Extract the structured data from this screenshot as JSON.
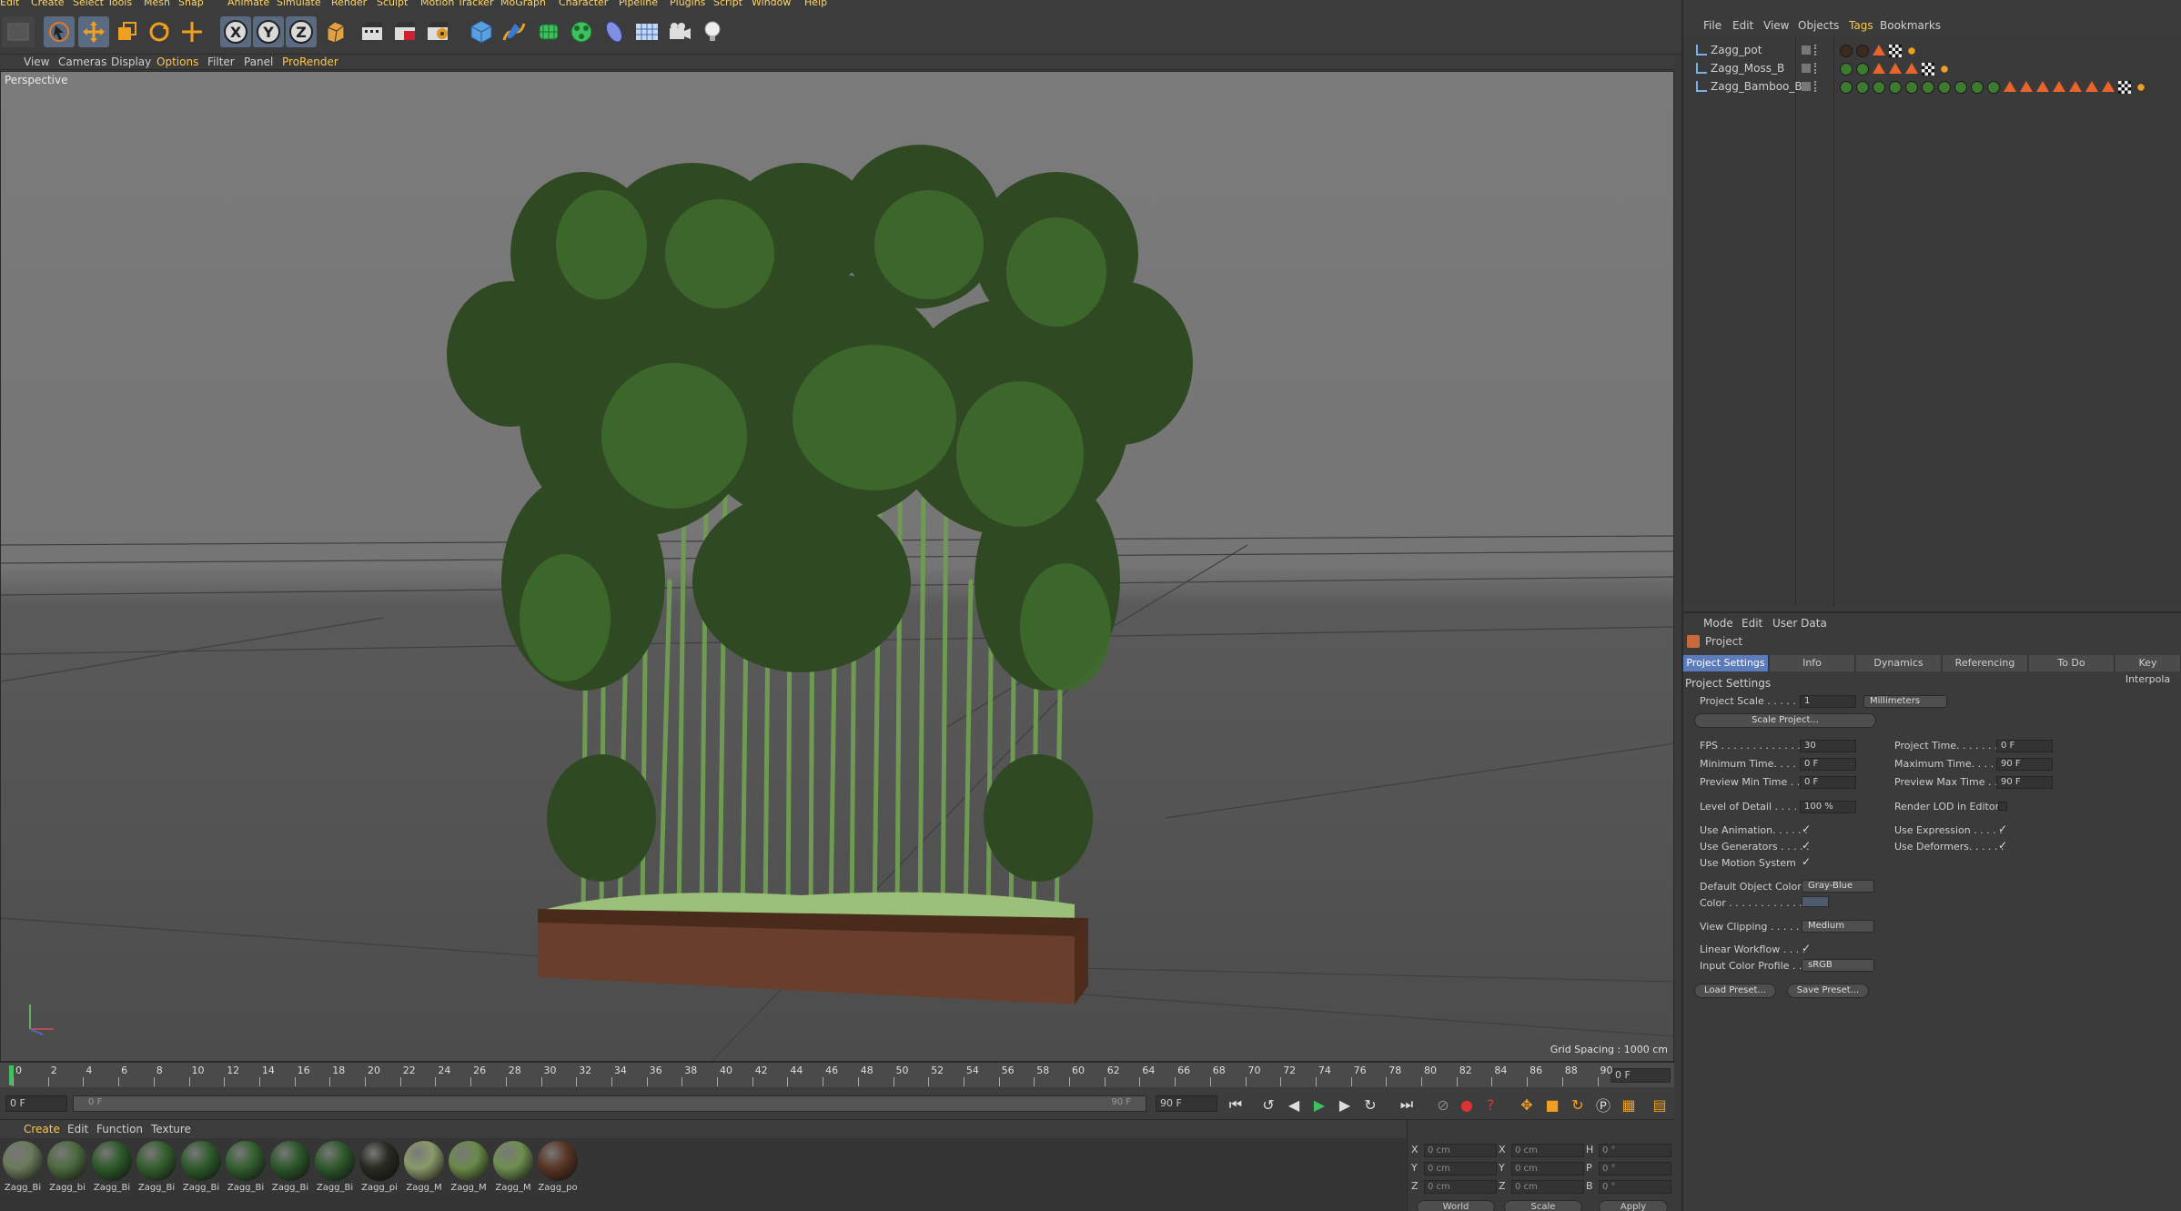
{
  "menubar": [
    "Edit",
    "Create",
    "Select",
    "Tools",
    "Mesh",
    "Snap",
    "Animate",
    "Simulate",
    "Render",
    "Sculpt",
    "Motion Tracker",
    "MoGraph",
    "Character",
    "Pipeline",
    "Plugins",
    "Script",
    "Window",
    "Help"
  ],
  "viewport": {
    "menu": [
      "View",
      "Cameras",
      "Display",
      "Options",
      "Filter",
      "Panel",
      "ProRender"
    ],
    "label": "Perspective",
    "grid_spacing": "Grid Spacing : 1000 cm"
  },
  "timeline": {
    "ticks": [
      "0",
      "2",
      "4",
      "6",
      "8",
      "10",
      "12",
      "14",
      "16",
      "18",
      "20",
      "22",
      "24",
      "26",
      "28",
      "30",
      "32",
      "34",
      "36",
      "38",
      "40",
      "42",
      "44",
      "46",
      "48",
      "50",
      "52",
      "54",
      "56",
      "58",
      "60",
      "62",
      "64",
      "66",
      "68",
      "70",
      "72",
      "74",
      "76",
      "78",
      "80",
      "82",
      "84",
      "86",
      "88",
      "90"
    ],
    "current_frame": "0 F"
  },
  "transport": {
    "start": "0 F",
    "range_start": "0 F",
    "range_end": "90 F",
    "end": "90 F"
  },
  "materials": {
    "menu": [
      "Create",
      "Edit",
      "Function",
      "Texture"
    ],
    "items": [
      {
        "label": "Zagg_Bi",
        "color": "#6a7a5a"
      },
      {
        "label": "Zagg_bi",
        "color": "#4d6a3f"
      },
      {
        "label": "Zagg_Bi",
        "color": "#2e5a2a"
      },
      {
        "label": "Zagg_Bi",
        "color": "#355f30"
      },
      {
        "label": "Zagg_Bi",
        "color": "#2f5c2d"
      },
      {
        "label": "Zagg_Bi",
        "color": "#33602f"
      },
      {
        "label": "Zagg_Bi",
        "color": "#2d582b"
      },
      {
        "label": "Zagg_Bi",
        "color": "#2e5a2c"
      },
      {
        "label": "Zagg_pi",
        "color": "#2a2a22"
      },
      {
        "label": "Zagg_M",
        "color": "#8a9a6a"
      },
      {
        "label": "Zagg_M",
        "color": "#6a8a4a"
      },
      {
        "label": "Zagg_M",
        "color": "#6f8f50"
      },
      {
        "label": "Zagg_po",
        "color": "#5a3626"
      }
    ]
  },
  "coords": {
    "rows": [
      {
        "a": "X",
        "av": "0 cm",
        "b": "X",
        "bv": "0 cm",
        "c": "H",
        "cv": "0 °"
      },
      {
        "a": "Y",
        "av": "0 cm",
        "b": "Y",
        "bv": "0 cm",
        "c": "P",
        "cv": "0 °"
      },
      {
        "a": "Z",
        "av": "0 cm",
        "b": "Z",
        "bv": "0 cm",
        "c": "B",
        "cv": "0 °"
      }
    ],
    "world": "World",
    "scale": "Scale",
    "apply": "Apply"
  },
  "object_manager": {
    "menu": [
      "File",
      "Edit",
      "View",
      "Objects",
      "Tags",
      "Bookmarks"
    ],
    "objects": [
      "Zagg_pot",
      "Zagg_Moss_B",
      "Zagg_Bamboo_B"
    ]
  },
  "attributes": {
    "menu": [
      "Mode",
      "Edit",
      "User Data"
    ],
    "title": "Project",
    "tabs": [
      "Project Settings",
      "Info",
      "Dynamics",
      "Referencing",
      "To Do",
      "Key Interpola"
    ],
    "section": "Project Settings",
    "project_scale_label": "Project Scale . . . . . .",
    "project_scale_value": "1",
    "project_scale_unit": "Millimeters",
    "scale_project": "Scale Project...",
    "fps_label": "FPS . . . . . . . . . . . . . . .",
    "fps": "30",
    "project_time_label": "Project Time. . . . . . . .",
    "project_time": "0 F",
    "min_time_label": "Minimum Time. . . . . .",
    "min_time": "0 F",
    "max_time_label": "Maximum Time. . . . . .",
    "max_time": "90 F",
    "prev_min_label": "Preview Min Time . . .",
    "prev_min": "0 F",
    "prev_max_label": "Preview Max Time . . .",
    "prev_max": "90 F",
    "lod_label": "Level of Detail . . . . . .",
    "lod": "100 %",
    "render_lod_label": "Render LOD in Editor",
    "use_anim": "Use Animation. . . . . .",
    "use_expr": "Use Expression . . . . .",
    "use_gen": "Use Generators . . . . .",
    "use_def": "Use Deformers. . . . . .",
    "use_motion": "Use Motion System",
    "doc_label": "Default Object Color",
    "doc_value": "Gray-Blue",
    "color_label": "Color . . . . . . . . . . . . .",
    "clip_label": "View Clipping . . . . . .",
    "clip_value": "Medium",
    "lw_label": "Linear Workflow . . . .",
    "icp_label": "Input Color Profile . . .",
    "icp_value": "sRGB",
    "load_preset": "Load Preset...",
    "save_preset": "Save Preset..."
  }
}
